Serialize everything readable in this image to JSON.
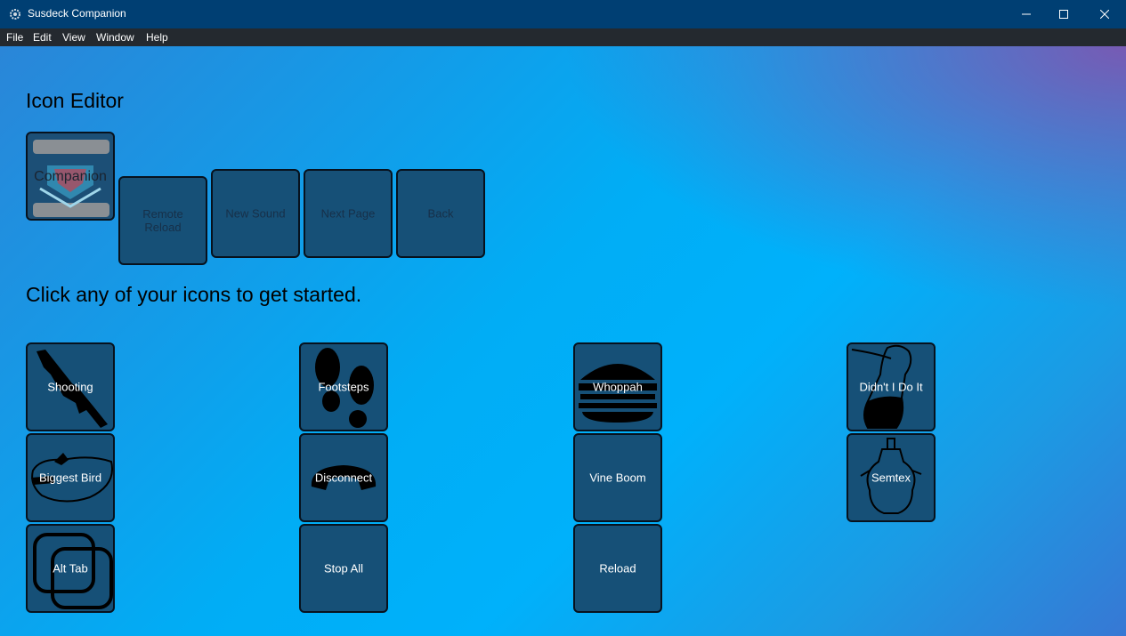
{
  "window": {
    "title": "Susdeck Companion",
    "icon": "gear-app-icon",
    "controls": [
      "minimize-icon",
      "maximize-icon",
      "close-icon"
    ]
  },
  "menu": [
    "File",
    "Edit",
    "View",
    "Window",
    "Help"
  ],
  "editor": {
    "heading": "Icon Editor",
    "preview_text": "Companion",
    "actions": [
      "Remote Reload",
      "New Sound",
      "Next Page",
      "Back"
    ]
  },
  "prompt": "Click any of your icons to get started.",
  "icons": [
    {
      "label": "Shooting",
      "icon": "rifle-icon"
    },
    {
      "label": "Footsteps",
      "icon": "footprints-icon"
    },
    {
      "label": "Whoppah",
      "icon": "burger-icon"
    },
    {
      "label": "Didn't I Do It",
      "icon": "bottle-icon"
    },
    {
      "label": "Biggest Bird",
      "icon": "roast-bird-icon"
    },
    {
      "label": "Disconnect",
      "icon": "phone-handset-icon"
    },
    {
      "label": "Vine Boom",
      "icon": ""
    },
    {
      "label": "Semtex",
      "icon": "grenade-icon"
    },
    {
      "label": "Alt Tab",
      "icon": "overlapping-squares-icon"
    },
    {
      "label": "Stop All",
      "icon": ""
    },
    {
      "label": "Reload",
      "icon": ""
    }
  ],
  "colors": {
    "titlebar": "#003f73",
    "menubar": "#24292f",
    "tile": "#165077",
    "gradient_main": "#00b1fb",
    "gradient_corner": "#7d56b0"
  }
}
